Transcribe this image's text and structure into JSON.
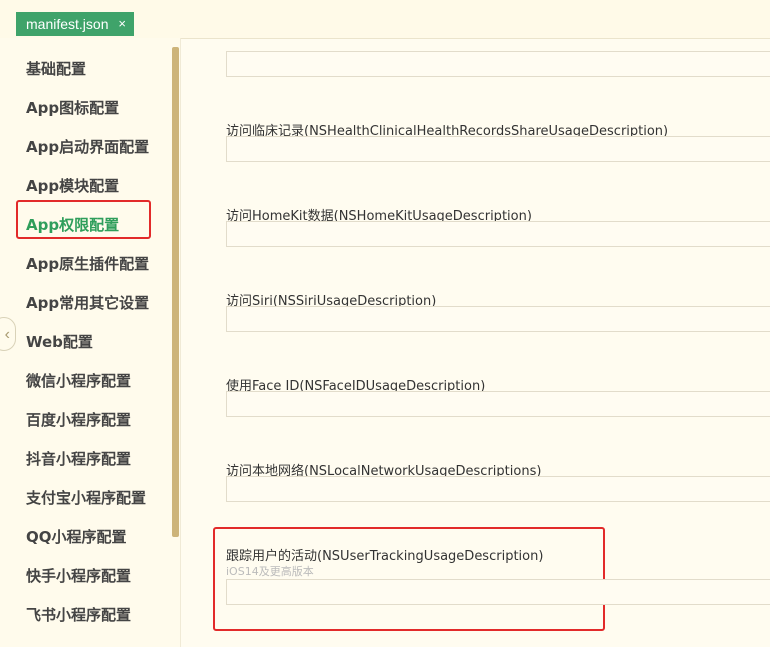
{
  "tab": {
    "label": "manifest.json",
    "close": "×"
  },
  "sidebar": {
    "items": [
      {
        "label": "基础配置"
      },
      {
        "label": "App图标配置"
      },
      {
        "label": "App启动界面配置"
      },
      {
        "label": "App模块配置"
      },
      {
        "label": "App权限配置",
        "active": true
      },
      {
        "label": "App原生插件配置"
      },
      {
        "label": "App常用其它设置"
      },
      {
        "label": "Web配置"
      },
      {
        "label": "微信小程序配置"
      },
      {
        "label": "百度小程序配置"
      },
      {
        "label": "抖音小程序配置"
      },
      {
        "label": "支付宝小程序配置"
      },
      {
        "label": "QQ小程序配置"
      },
      {
        "label": "快手小程序配置"
      },
      {
        "label": "飞书小程序配置"
      }
    ],
    "collapse_glyph": "‹"
  },
  "fields": [
    {
      "label": "访问临床记录(NSHealthClinicalHealthRecordsShareUsageDescription)",
      "value": ""
    },
    {
      "label": "访问HomeKit数据(NSHomeKitUsageDescription)",
      "value": ""
    },
    {
      "label": "访问Siri(NSSiriUsageDescription)",
      "value": ""
    },
    {
      "label": "使用Face ID(NSFaceIDUsageDescription)",
      "value": ""
    },
    {
      "label": "访问本地网络(NSLocalNetworkUsageDescriptions)",
      "value": ""
    },
    {
      "label": "跟踪用户的活动(NSUserTrackingUsageDescription)",
      "hint": "iOS14及更高版本",
      "value": ""
    }
  ],
  "colors": {
    "accent": "#3fa36a",
    "highlight": "#e22a2a",
    "scrollbar": "#cdb47a"
  }
}
